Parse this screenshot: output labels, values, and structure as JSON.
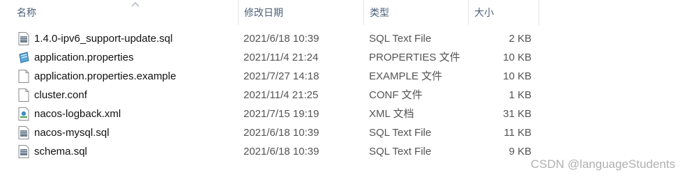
{
  "columns": {
    "name": "名称",
    "modified": "修改日期",
    "type": "类型",
    "size": "大小"
  },
  "files": [
    {
      "name": "1.4.0-ipv6_support-update.sql",
      "modified": "2021/6/18 10:39",
      "type": "SQL Text File",
      "size": "2 KB",
      "icon": "sql-file-icon"
    },
    {
      "name": "application.properties",
      "modified": "2021/11/4 21:24",
      "type": "PROPERTIES 文件",
      "size": "10 KB",
      "icon": "properties-file-icon"
    },
    {
      "name": "application.properties.example",
      "modified": "2021/7/27 14:18",
      "type": "EXAMPLE 文件",
      "size": "10 KB",
      "icon": "generic-file-icon"
    },
    {
      "name": "cluster.conf",
      "modified": "2021/11/4 21:25",
      "type": "CONF 文件",
      "size": "1 KB",
      "icon": "generic-file-icon"
    },
    {
      "name": "nacos-logback.xml",
      "modified": "2021/7/15 19:19",
      "type": "XML 文档",
      "size": "31 KB",
      "icon": "xml-file-icon"
    },
    {
      "name": "nacos-mysql.sql",
      "modified": "2021/6/18 10:39",
      "type": "SQL Text File",
      "size": "11 KB",
      "icon": "sql-file-icon"
    },
    {
      "name": "schema.sql",
      "modified": "2021/6/18 10:39",
      "type": "SQL Text File",
      "size": "9 KB",
      "icon": "sql-file-icon"
    }
  ],
  "watermark": "CSDN @languageStudents"
}
